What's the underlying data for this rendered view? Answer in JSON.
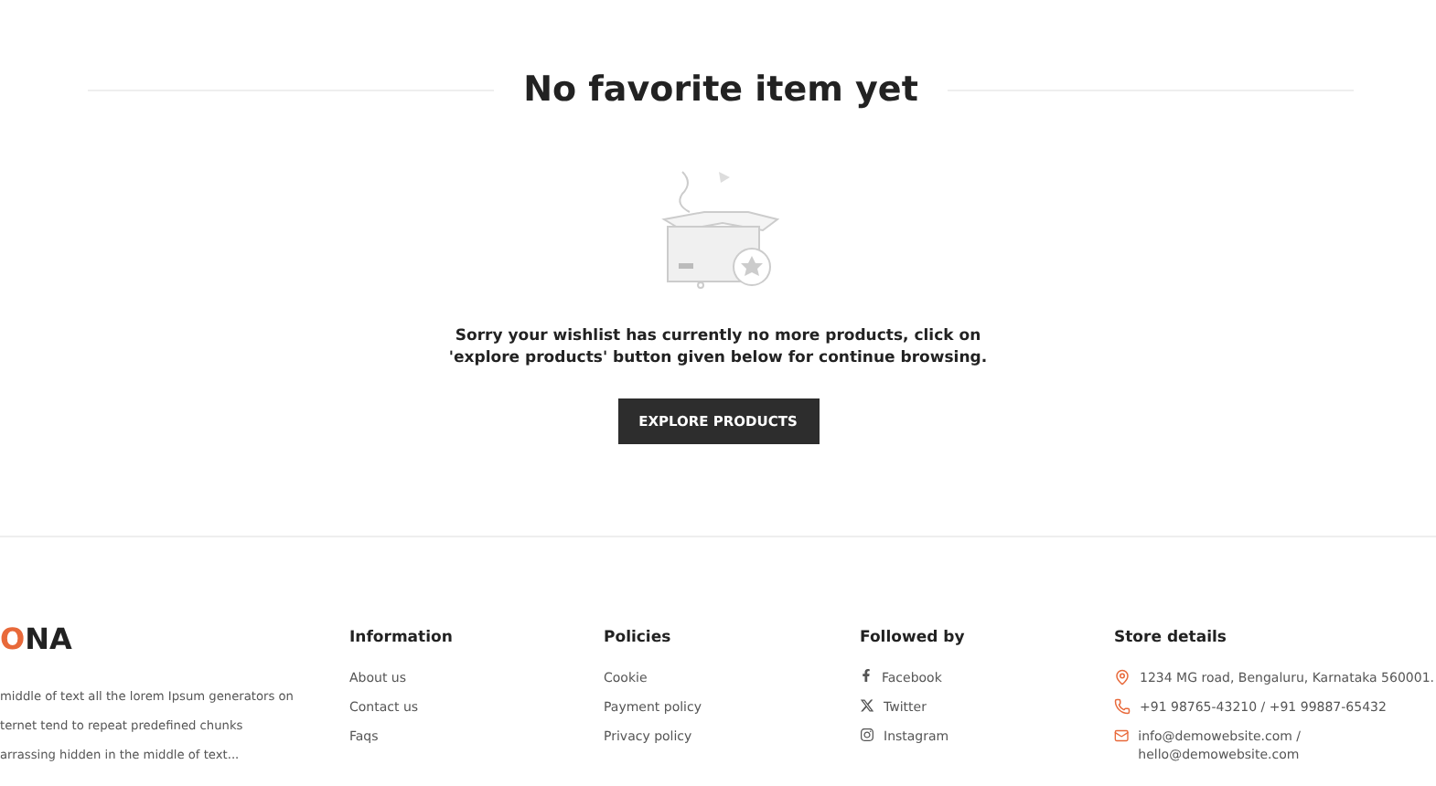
{
  "heading": "No favorite item yet",
  "message": "Sorry your wishlist has currently no more products, click on 'explore products' button given below for continue browsing.",
  "button": "EXPLORE PRODUCTS",
  "footer": {
    "logo": {
      "accent": "O",
      "rest": "NA"
    },
    "about": [
      "middle of text all the lorem Ipsum generators on",
      "ternet tend to repeat predefined chunks",
      "arrassing hidden in the middle of text..."
    ],
    "columns": [
      {
        "title": "Information",
        "links": [
          {
            "label": "About us"
          },
          {
            "label": "Contact us"
          },
          {
            "label": "Faqs"
          }
        ]
      },
      {
        "title": "Policies",
        "links": [
          {
            "label": "Cookie"
          },
          {
            "label": "Payment policy"
          },
          {
            "label": "Privacy policy"
          }
        ]
      },
      {
        "title": "Followed by",
        "links": [
          {
            "label": "Facebook",
            "kind": "facebook"
          },
          {
            "label": "Twitter",
            "kind": "x"
          },
          {
            "label": "Instagram",
            "kind": "instagram"
          }
        ]
      },
      {
        "title": "Store details",
        "links": [
          {
            "label": "1234 MG road, Bengaluru, Karnataka 560001.",
            "kind": "pin"
          },
          {
            "label": "+91 98765-43210 / +91 99887-65432",
            "kind": "phone"
          },
          {
            "label": "info@demowebsite.com / hello@demowebsite.com",
            "kind": "mail"
          }
        ]
      }
    ]
  }
}
